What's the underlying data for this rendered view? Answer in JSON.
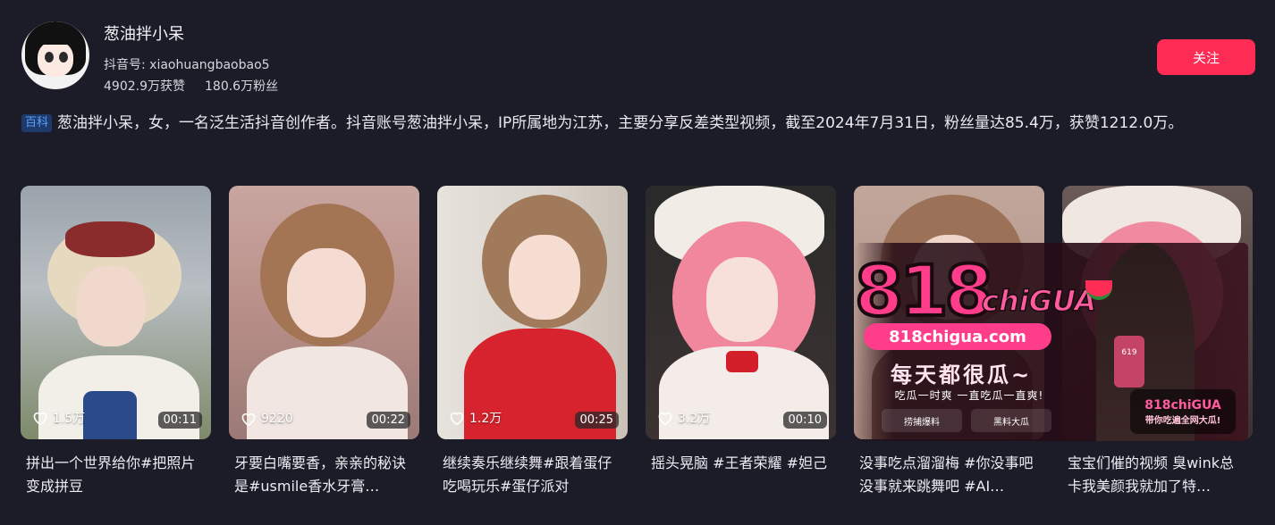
{
  "profile": {
    "name": "葱油拌小呆",
    "douyin_id": "抖音号: xiaohuangbaobao5",
    "likes": "4902.9万获赞",
    "followers": "180.6万粉丝",
    "follow_label": "关注"
  },
  "bio": {
    "tag": "百科",
    "text": "葱油拌小呆，女，一名泛生活抖音创作者。抖音账号葱油拌小呆，IP所属地为江苏，主要分享反差类型视频，截至2024年7月31日，粉丝量达85.4万，获赞1212.0万。"
  },
  "videos": [
    {
      "likes": "1.5万",
      "duration": "00:11",
      "caption": "拼出一个世界给你#把照片变成拼豆"
    },
    {
      "likes": "9220",
      "duration": "00:22",
      "caption": "牙要白嘴要香，亲亲的秘诀是#usmile香水牙膏…"
    },
    {
      "likes": "1.2万",
      "duration": "00:25",
      "caption": "继续奏乐继续舞#跟着蛋仔吃喝玩乐#蛋仔派对"
    },
    {
      "likes": "3.2万",
      "duration": "00:10",
      "caption": "摇头晃脑 #王者荣耀 #妲己"
    },
    {
      "likes": "",
      "duration": "",
      "caption": "没事吃点溜溜梅 #你没事吧没事就来跳舞吧 #AI…"
    },
    {
      "likes": "",
      "duration": "",
      "caption": "宝宝们催的视频 臭wink总卡我美颜我就加了特…"
    }
  ],
  "ad": {
    "logo": "818",
    "logo_sub": "chiGUA",
    "url": "818chigua.com",
    "slogan": "每天都很瓜~",
    "subline": "吃瓜一时爽 一直吃瓜一直爽!",
    "chip_1": "捞捕爆料",
    "chip_2": "黑料大瓜",
    "right_logo": "818chiGUA",
    "right_logo_sub": "带你吃遍全网大瓜!",
    "phone_text": "619"
  },
  "colors": {
    "background": "#1b1c28",
    "accent": "#fe2c55",
    "tag_bg": "#1e3a6b",
    "tag_fg": "#5aa0ff"
  }
}
